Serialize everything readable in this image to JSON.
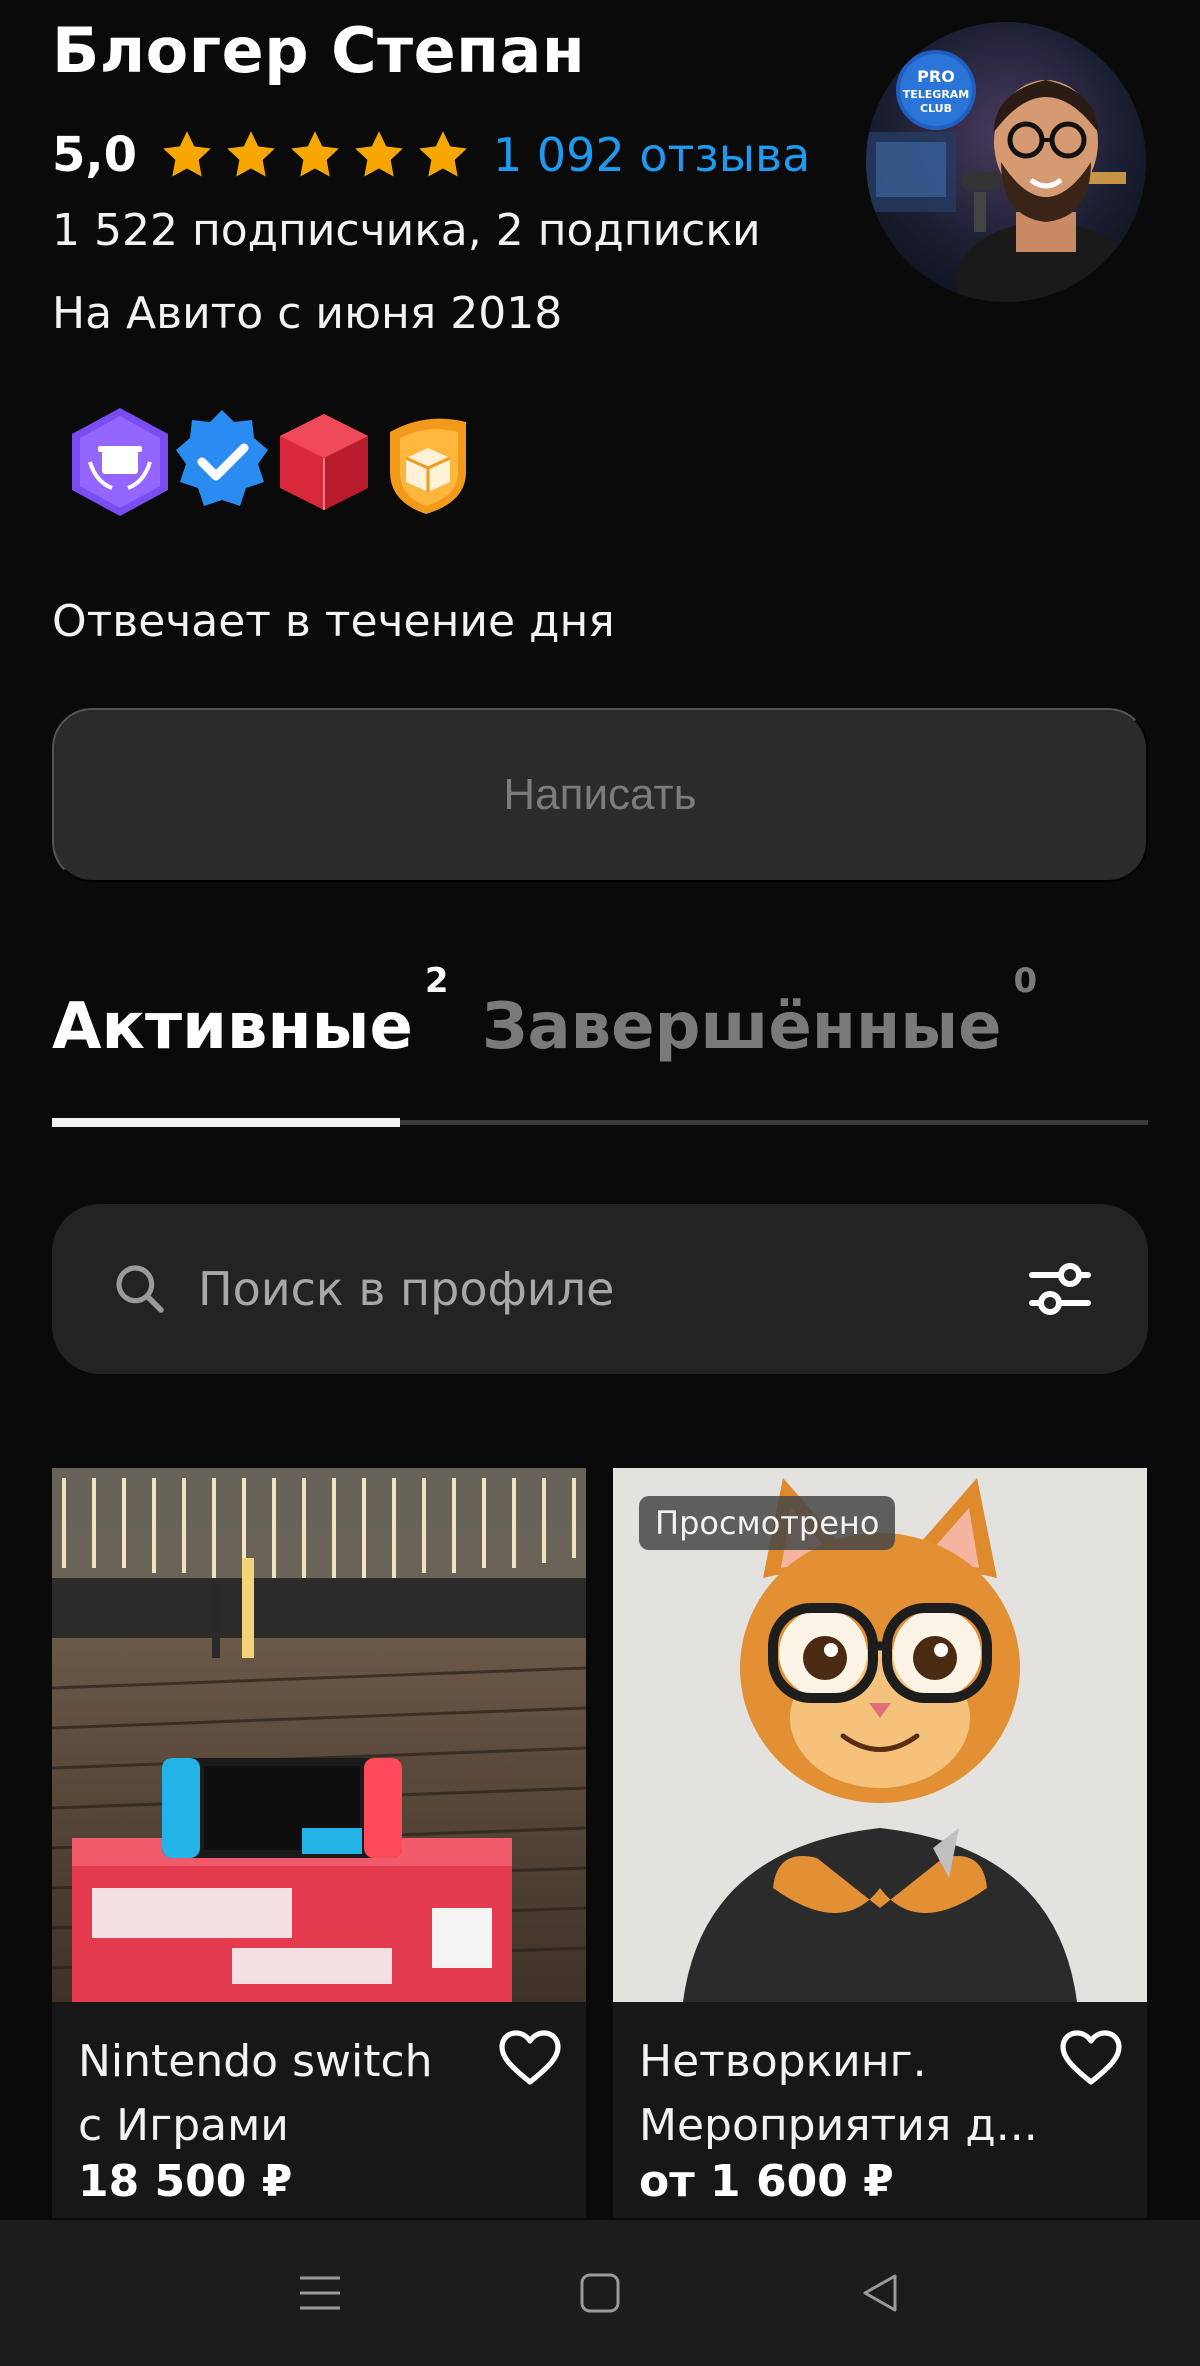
{
  "profile": {
    "name": "Блогер Степан",
    "rating": "5,0",
    "stars_filled": 5,
    "stars_total": 5,
    "reviews_link": "1 092 отзыва",
    "subscriptions": "1 522 подписчика, 2 подписки",
    "on_avito_since": "На Авито с июня 2018",
    "reply_time": "Отвечает в течение дня",
    "avatar_text_1": "PRO",
    "avatar_text_2": "TELEGRAM",
    "avatar_text_3": "CLUB"
  },
  "colors": {
    "accent_link": "#1e9bf0",
    "star": "#f7a600",
    "background": "#0a0a0a"
  },
  "badges": [
    "reliable-seller-badge",
    "verified-badge",
    "delivery-badge",
    "box-badge"
  ],
  "actions": {
    "write_label": "Написать"
  },
  "tabs": [
    {
      "label": "Активные",
      "count": "2",
      "active": true
    },
    {
      "label": "Завершённые",
      "count": "0",
      "active": false
    }
  ],
  "search": {
    "placeholder": "Поиск в профиле"
  },
  "listings": [
    {
      "title_line1": "Nintendo switch",
      "title_line2": "с Играми",
      "price": "18 500 ₽",
      "viewed": ""
    },
    {
      "title_line1": "Нетворкинг.",
      "title_line2": "Мероприятия д...",
      "price": "от 1 600 ₽",
      "viewed": "Просмотрено"
    }
  ],
  "navbar": [
    "menu-icon",
    "home-icon",
    "back-icon"
  ]
}
